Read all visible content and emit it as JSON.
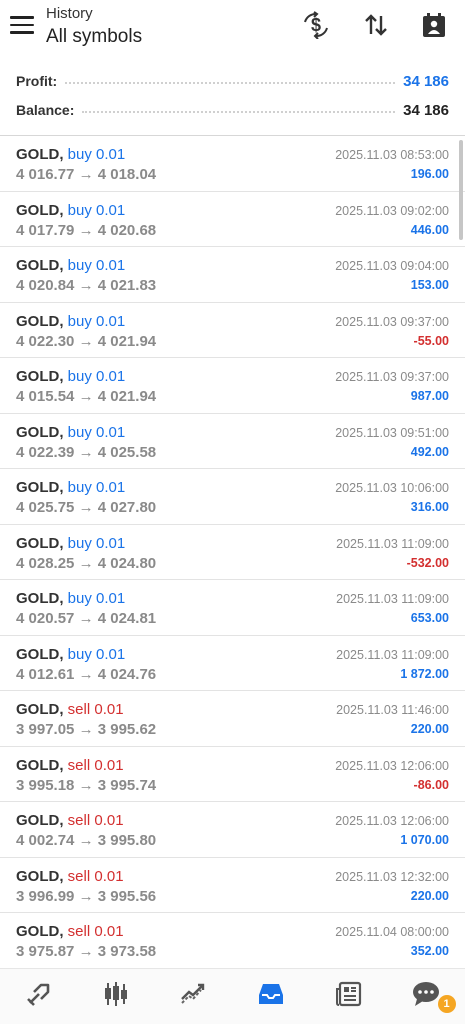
{
  "header": {
    "subtitle": "History",
    "title": "All symbols"
  },
  "summary": {
    "profit_label": "Profit:",
    "profit_value": "34 186",
    "balance_label": "Balance:",
    "balance_value": "34 186"
  },
  "deals": [
    {
      "symbol": "GOLD,",
      "side": "buy 0.01",
      "type": "buy",
      "open": "4 016.77",
      "close": "4 018.04",
      "time": "2025.11.03 08:53:00",
      "profit": "196.00",
      "sign": "pos"
    },
    {
      "symbol": "GOLD,",
      "side": "buy 0.01",
      "type": "buy",
      "open": "4 017.79",
      "close": "4 020.68",
      "time": "2025.11.03 09:02:00",
      "profit": "446.00",
      "sign": "pos"
    },
    {
      "symbol": "GOLD,",
      "side": "buy 0.01",
      "type": "buy",
      "open": "4 020.84",
      "close": "4 021.83",
      "time": "2025.11.03 09:04:00",
      "profit": "153.00",
      "sign": "pos"
    },
    {
      "symbol": "GOLD,",
      "side": "buy 0.01",
      "type": "buy",
      "open": "4 022.30",
      "close": "4 021.94",
      "time": "2025.11.03 09:37:00",
      "profit": "-55.00",
      "sign": "neg"
    },
    {
      "symbol": "GOLD,",
      "side": "buy 0.01",
      "type": "buy",
      "open": "4 015.54",
      "close": "4 021.94",
      "time": "2025.11.03 09:37:00",
      "profit": "987.00",
      "sign": "pos"
    },
    {
      "symbol": "GOLD,",
      "side": "buy 0.01",
      "type": "buy",
      "open": "4 022.39",
      "close": "4 025.58",
      "time": "2025.11.03 09:51:00",
      "profit": "492.00",
      "sign": "pos"
    },
    {
      "symbol": "GOLD,",
      "side": "buy 0.01",
      "type": "buy",
      "open": "4 025.75",
      "close": "4 027.80",
      "time": "2025.11.03 10:06:00",
      "profit": "316.00",
      "sign": "pos"
    },
    {
      "symbol": "GOLD,",
      "side": "buy 0.01",
      "type": "buy",
      "open": "4 028.25",
      "close": "4 024.80",
      "time": "2025.11.03 11:09:00",
      "profit": "-532.00",
      "sign": "neg"
    },
    {
      "symbol": "GOLD,",
      "side": "buy 0.01",
      "type": "buy",
      "open": "4 020.57",
      "close": "4 024.81",
      "time": "2025.11.03 11:09:00",
      "profit": "653.00",
      "sign": "pos"
    },
    {
      "symbol": "GOLD,",
      "side": "buy 0.01",
      "type": "buy",
      "open": "4 012.61",
      "close": "4 024.76",
      "time": "2025.11.03 11:09:00",
      "profit": "1 872.00",
      "sign": "pos"
    },
    {
      "symbol": "GOLD,",
      "side": "sell 0.01",
      "type": "sell",
      "open": "3 997.05",
      "close": "3 995.62",
      "time": "2025.11.03 11:46:00",
      "profit": "220.00",
      "sign": "pos"
    },
    {
      "symbol": "GOLD,",
      "side": "sell 0.01",
      "type": "sell",
      "open": "3 995.18",
      "close": "3 995.74",
      "time": "2025.11.03 12:06:00",
      "profit": "-86.00",
      "sign": "neg"
    },
    {
      "symbol": "GOLD,",
      "side": "sell 0.01",
      "type": "sell",
      "open": "4 002.74",
      "close": "3 995.80",
      "time": "2025.11.03 12:06:00",
      "profit": "1 070.00",
      "sign": "pos"
    },
    {
      "symbol": "GOLD,",
      "side": "sell 0.01",
      "type": "sell",
      "open": "3 996.99",
      "close": "3 995.56",
      "time": "2025.11.03 12:32:00",
      "profit": "220.00",
      "sign": "pos"
    },
    {
      "symbol": "GOLD,",
      "side": "sell 0.01",
      "type": "sell",
      "open": "3 975.87",
      "close": "3 973.58",
      "time": "2025.11.04 08:00:00",
      "profit": "352.00",
      "sign": "pos"
    }
  ],
  "arrow_glyph": "→",
  "header_icons": [
    "dollar-swap-icon",
    "sort-icon",
    "calendar-icon"
  ],
  "nav": {
    "items": [
      "quotes-icon",
      "chart-icon",
      "trade-icon",
      "history-icon",
      "news-icon",
      "chat-icon"
    ],
    "active": "history-icon",
    "chat_badge": "1"
  },
  "colors": {
    "accent": "#1a73e8",
    "negative": "#d32f2f",
    "muted": "#8a8a8a",
    "badge": "#f5a623"
  }
}
